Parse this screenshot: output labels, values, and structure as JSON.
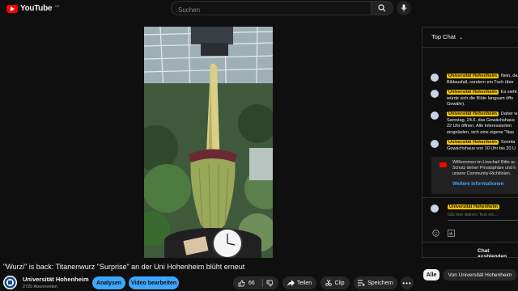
{
  "header": {
    "logo_text": "YouTube",
    "logo_region": "DE",
    "search_placeholder": "Suchen"
  },
  "video": {
    "title": "\"Wurzi\" is back: Titanenwurz \"Surprise\" an der Uni Hohenheim blüht erneut"
  },
  "channel": {
    "name": "Universität Hohenheim",
    "subscribers": "2720 Abonnenten",
    "analytics_label": "Analysen",
    "edit_label": "Video bearbeiten"
  },
  "actions": {
    "like_count": "66",
    "share_label": "Teilen",
    "clip_label": "Clip",
    "save_label": "Speichern"
  },
  "filters": {
    "all_label": "Alle",
    "channel_label": "Von Universität Hohenheim"
  },
  "chat": {
    "title": "Top Chat",
    "messages": [
      {
        "author": "Universität Hohenheim",
        "line1": "Nein, da",
        "line2": "Bildausfall, sondern ein Tuch über"
      },
      {
        "author": "Universität Hohenheim",
        "line1": "Es sieht",
        "line2": "würde sich die Blüte langsam öffn",
        "line3": "Gewähr)."
      },
      {
        "author": "Universität Hohenheim",
        "line1": "Daher w",
        "line2": "Samstag, 24.6. das Gewächshaus",
        "line3": "22 Uhr öffnen. Alle Interessierten",
        "line4": "eingeladen, sich eine eigene \"Nas"
      },
      {
        "author": "Universität Hohenheim",
        "line1": "Sonnta",
        "line2": "Gewächshaus von 10 Uhr bis 20 U"
      }
    ],
    "notice_lines": [
      "Willkommen im Livechat! Bitte ac",
      "Schutz deiner Privatsphäre und h",
      "unsere Community-Richtlinien."
    ],
    "notice_link": "Weitere Informationen",
    "input_author": "Universität Hohenheim",
    "input_placeholder": "Gib hier deinen Text ein...",
    "hide_label": "Chat ausblenden"
  },
  "colors": {
    "accent_blue": "#3ea6ff",
    "youtube_red": "#ff0000",
    "badge_yellow": "#f7c600",
    "background": "#0f0f0f"
  }
}
